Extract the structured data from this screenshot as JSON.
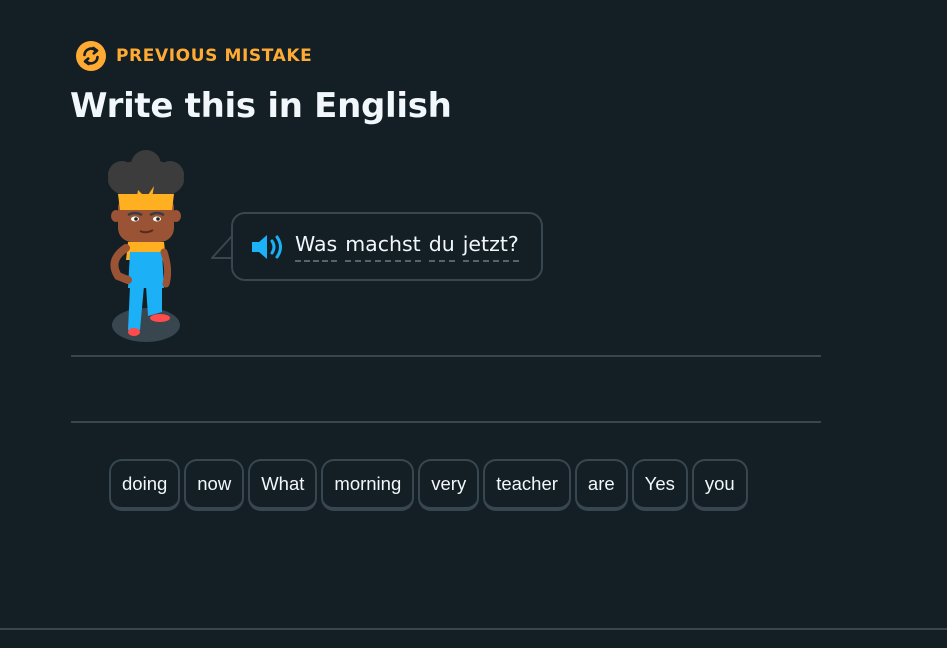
{
  "header": {
    "badge_label": "PREVIOUS MISTAKE",
    "badge_icon": "refresh-icon",
    "title": "Write this in English"
  },
  "prompt": {
    "speaker_icon": "speaker-icon",
    "words": [
      "Was",
      "machst",
      "du",
      "jetzt?"
    ]
  },
  "word_bank": [
    "doing",
    "now",
    "What",
    "morning",
    "very",
    "teacher",
    "are",
    "Yes",
    "you"
  ],
  "colors": {
    "background": "#131f24",
    "accent_orange": "#ffaa33",
    "border": "#37464f",
    "text": "#f1f7fb",
    "speaker_blue": "#1cb0f6"
  }
}
